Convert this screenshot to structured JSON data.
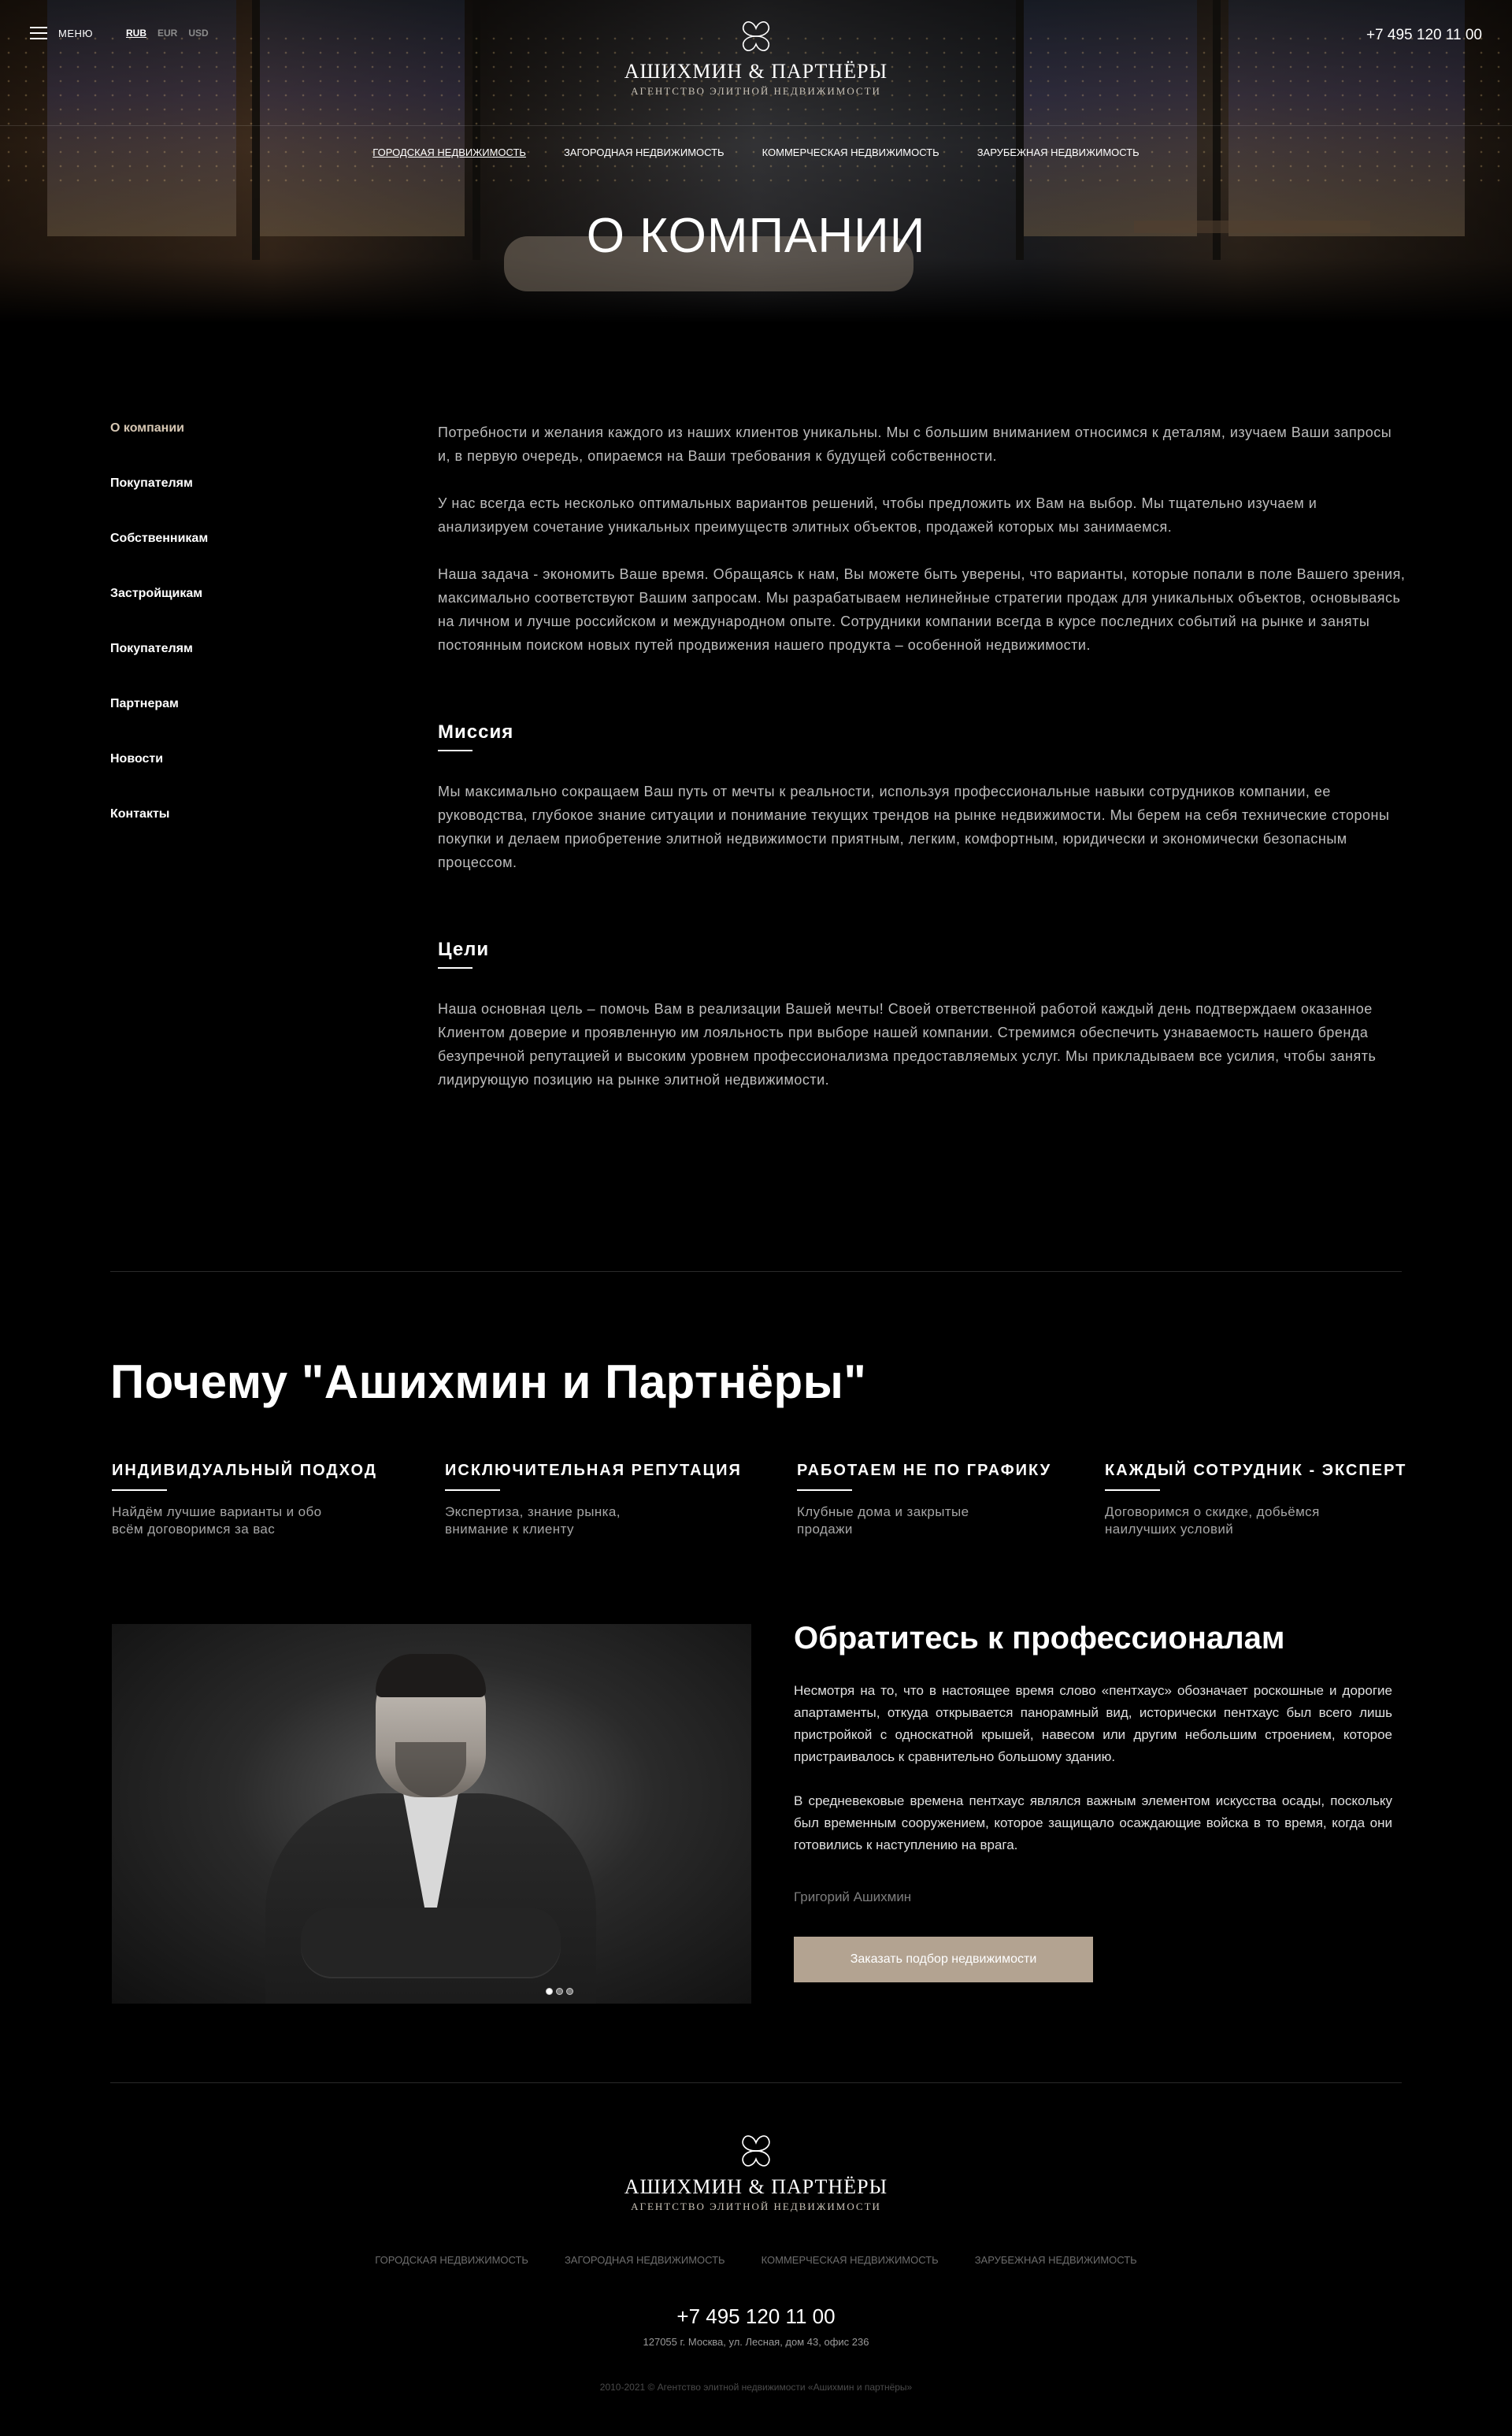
{
  "header": {
    "menu_label": "МЕНЮ",
    "currencies": [
      {
        "label": "RUB",
        "active": true
      },
      {
        "label": "EUR",
        "active": false
      },
      {
        "label": "USD",
        "active": false
      }
    ],
    "phone": "+7 495 120 11 00",
    "logo_title": "АШИХМИН & ПАРТНЁРЫ",
    "logo_subtitle": "АГЕНТСТВО ЭЛИТНОЙ НЕДВИЖИМОСТИ",
    "nav": [
      {
        "label": "ГОРОДСКАЯ НЕДВИЖИМОСТЬ",
        "active": true
      },
      {
        "label": "ЗАГОРОДНАЯ НЕДВИЖИМОСТЬ",
        "active": false
      },
      {
        "label": "КОММЕРЧЕСКАЯ НЕДВИЖИМОСТЬ",
        "active": false
      },
      {
        "label": "ЗАРУБЕЖНАЯ НЕДВИЖИМОСТЬ",
        "active": false
      }
    ]
  },
  "page_title": "О КОМПАНИИ",
  "sidebar": {
    "items": [
      {
        "label": "О компании",
        "active": true
      },
      {
        "label": "Покупателям",
        "active": false
      },
      {
        "label": "Собственникам",
        "active": false
      },
      {
        "label": "Застройщикам",
        "active": false
      },
      {
        "label": "Покупателям",
        "active": false
      },
      {
        "label": "Партнерам",
        "active": false
      },
      {
        "label": "Новости",
        "active": false
      },
      {
        "label": "Контакты",
        "active": false
      }
    ]
  },
  "about": {
    "paragraphs": [
      "Потребности и желания каждого из наших клиентов уникальны. Мы с большим вниманием относимся к деталям, изучаем Ваши запросы и, в первую очередь, опираемся на Ваши требования к будущей собственности.",
      "У нас всегда есть несколько оптимальных вариантов решений, чтобы предложить их Вам на выбор. Мы тщательно изучаем и анализируем сочетание уникальных преимуществ элитных объектов, продажей которых мы занимаемся.",
      "Наша задача - экономить Ваше время. Обращаясь к нам, Вы можете быть уверены, что варианты, которые попали в поле Вашего зрения, максимально соответствуют Вашим запросам. Мы разрабатываем нелинейные стратегии продаж для уникальных объектов, основываясь на личном и лучше российском и международном опыте. Сотрудники компании всегда в курсе последних событий на рынке и заняты постоянным поиском новых путей продвижения нашего продукта – особенной недвижимости."
    ],
    "mission_title": "Миссия",
    "mission_text": "Мы максимально сокращаем Ваш путь от мечты к реальности, используя профессиональные навыки сотрудников компании, ее руководства, глубокое знание ситуации и понимание текущих трендов на рынке недвижимости. Мы берем на себя технические стороны покупки и делаем приобретение элитной недвижимости приятным, легким, комфортным, юридически и экономически безопасным процессом.",
    "goals_title": "Цели",
    "goals_text": "Наша основная цель – помочь Вам в реализации Вашей мечты! Своей ответственной работой каждый день подтверждаем оказанное Клиентом доверие и проявленную им лояльность при выборе нашей компании. Стремимся обеспечить узнаваемость нашего бренда безупречной репутацией и высоким уровнем профессионализма предоставляемых услуг. Мы прикладываем все усилия, чтобы занять лидирующую позицию на рынке элитной недвижимости."
  },
  "why": {
    "title": "Почему \"Ашихмин и Партнёры\"",
    "features": [
      {
        "title": "ИНДИВИДУАЛЬНЫЙ ПОДХОД",
        "text": "Найдём лучшие варианты и обо всём договоримся за вас"
      },
      {
        "title": "ИСКЛЮЧИТЕЛЬНАЯ РЕПУТАЦИЯ",
        "text": "Экспертиза, знание рынка, внимание к клиенту"
      },
      {
        "title": "РАБОТАЕМ НЕ ПО ГРАФИКУ",
        "text": "Клубные дома и закрытые продажи"
      },
      {
        "title": "КАЖДЫЙ СОТРУДНИК - ЭКСПЕРТ",
        "text": "Договоримся о скидке, добьёмся наилучших условий"
      }
    ]
  },
  "contact_pro": {
    "title": "Обратитесь к профессионалам",
    "paragraphs": [
      "Несмотря на то, что в настоящее время слово «пентхаус» обозначает роскошные и дорогие апартаменты, откуда открывается панорамный вид, исторически пентхаус был всего лишь пристройкой с односкатной крышей, навесом или другим небольшим строением, которое пристраивалось к сравнительно большому зданию.",
      "В средневековые времена пентхаус являлся важным элементом искусства осады, поскольку был временным сооружением, которое защищало осаждающие войска в то время, когда они готовились к наступлению на врага."
    ],
    "author": "Григорий Ашихмин",
    "button_label": "Заказать подбор недвижимости",
    "slider_dots": 3,
    "slider_active": 1
  },
  "footer": {
    "logo_title": "АШИХМИН & ПАРТНЁРЫ",
    "logo_subtitle": "АГЕНТСТВО ЭЛИТНОЙ НЕДВИЖИМОСТИ",
    "nav": [
      "ГОРОДСКАЯ НЕДВИЖИМОСТЬ",
      "ЗАГОРОДНАЯ НЕДВИЖИМОСТЬ",
      "КОММЕРЧЕСКАЯ НЕДВИЖИМОСТЬ",
      "ЗАРУБЕЖНАЯ НЕДВИЖИМОСТЬ"
    ],
    "phone": "+7 495 120 11 00",
    "address": "127055 г. Москва, ул. Лесная, дом 43, офис 236",
    "copyright": "2010-2021 © Агентство элитной недвижимости «Ашихмин и партнёры»"
  },
  "colors": {
    "background": "#000000",
    "accent": "#b3a391",
    "active_sidebar": "#d6c7b3"
  }
}
